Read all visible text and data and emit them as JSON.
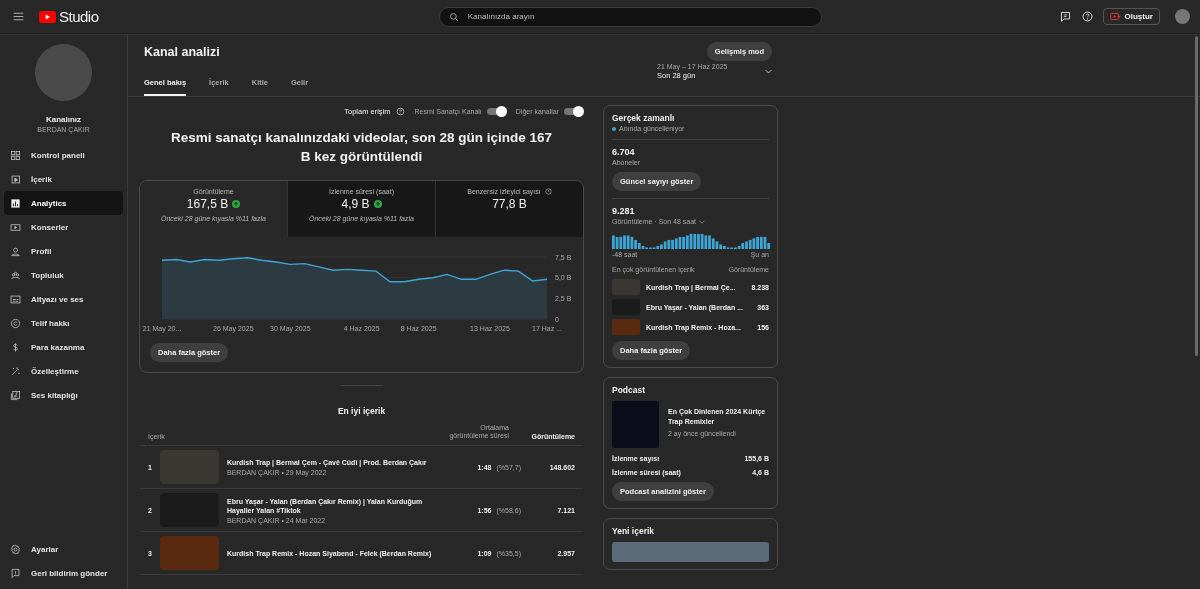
{
  "topbar": {
    "logo": "Studio",
    "search_placeholder": "Kanalınızda arayın",
    "create": "Oluştur"
  },
  "sidebar": {
    "channel_label": "Kanalınız",
    "channel_name": "BERDAN ÇAKIR",
    "items": [
      {
        "label": "Kontrol paneli",
        "selected": false
      },
      {
        "label": "İçerik",
        "selected": false
      },
      {
        "label": "Analytics",
        "selected": true
      },
      {
        "label": "Konserler",
        "selected": false
      },
      {
        "label": "Profil",
        "selected": false
      },
      {
        "label": "Topluluk",
        "selected": false
      },
      {
        "label": "Altyazı ve ses",
        "selected": false
      },
      {
        "label": "Telif hakkı",
        "selected": false
      },
      {
        "label": "Para kazanma",
        "selected": false
      },
      {
        "label": "Özelleştirme",
        "selected": false
      },
      {
        "label": "Ses kitaplığı",
        "selected": false
      }
    ],
    "footer": [
      "Ayarlar",
      "Geri bildirim gönder"
    ]
  },
  "header": {
    "title": "Kanal analizi",
    "advanced_button": "Gelişmiş mod",
    "date_range": "21 May – 17 Haz 2025",
    "period": "Son 28 gün",
    "tabs": [
      {
        "label": "Genel bakış",
        "selected": true
      },
      {
        "label": "İçerik",
        "selected": false
      },
      {
        "label": "Kitle",
        "selected": false
      },
      {
        "label": "Gelir",
        "selected": false
      }
    ]
  },
  "filters": {
    "total_reach": "Toplam erişim",
    "toggles": [
      {
        "label": "Resmi Sanatçı Kanalı",
        "on": true
      },
      {
        "label": "Diğer kanallar",
        "on": true
      }
    ]
  },
  "headline": "Resmi sanatçı kanalınızdaki videolar, son 28 gün içinde 167 B kez görüntülendi",
  "metrics": [
    {
      "label": "Görüntüleme",
      "value": "167,5 B",
      "trend_up": true,
      "note": "Önceki 28 güne kıyasla %11 fazla",
      "selected": true
    },
    {
      "label": "İzlenme süresi (saat)",
      "value": "4,9 B",
      "trend_up": true,
      "note": "Önceki 28 güne kıyasla %11 fazla",
      "selected": false
    },
    {
      "label": "Benzersiz izleyici sayısı",
      "value": "77,8 B",
      "trend_up": false,
      "selected": false
    }
  ],
  "chart_data": {
    "type": "area",
    "categories": [
      "21 May 20...",
      null,
      null,
      null,
      null,
      "26 May 2025",
      null,
      null,
      null,
      "30 May 2025",
      null,
      null,
      null,
      null,
      "4 Haz 2025",
      null,
      null,
      null,
      "8 Haz 2025",
      null,
      null,
      null,
      null,
      "13 Haz 2025",
      null,
      null,
      null,
      "17 Haz ..."
    ],
    "series": [
      {
        "color": "#3ea6d6",
        "values": [
          7.1,
          7.2,
          6.9,
          7.2,
          7.1,
          7.3,
          7.4,
          7.1,
          6.9,
          6.6,
          6.7,
          6.3,
          5.9,
          6.0,
          5.9,
          5.8,
          4.5,
          4.5,
          4.8,
          5.0,
          5.4,
          4.8,
          4.8,
          5.4,
          5.9,
          5.8,
          4.6,
          4.8
        ]
      }
    ],
    "ylim": [
      0,
      7.5
    ],
    "yticks": [
      {
        "value": 0,
        "label": "0"
      },
      {
        "value": 2.5,
        "label": "2,5 B"
      },
      {
        "value": 5,
        "label": "5,0 B"
      },
      {
        "value": 7.5,
        "label": "7,5 B"
      }
    ]
  },
  "more_button": "Daha fazla göster",
  "top_content": {
    "title": "En iyi içerik",
    "columns": [
      "İçerik",
      "Ortalama görüntüleme süresi",
      "Görüntüleme"
    ],
    "rows": [
      {
        "rank": "1",
        "title": "Kurdish Trap | Bermal Çem - Çavê Cûdî | Prod. Berdan Çakır",
        "meta": "BERDAN ÇAKIR • 29 May 2022",
        "duration": "1:48",
        "percent": "(%57,7)",
        "views": "148.602"
      },
      {
        "rank": "2",
        "title": "Ebru Yaşar - Yalan (Berdan Çakır Remix) | Yalan Kurduğum Hayaller Yalan #Tiktok",
        "meta": "BERDAN ÇAKIR • 24 Mar 2022",
        "duration": "1:56",
        "percent": "(%58,6)",
        "views": "7.121"
      },
      {
        "rank": "3",
        "title": "Kurdish Trap Remix - Hozan Siyabend - Felek (Berdan Remix)",
        "duration": "1:09",
        "percent": "(%35,5)",
        "views": "2.957"
      }
    ]
  },
  "realtime": {
    "title": "Gerçek zamanlı",
    "status": "Anında güncelleniyor",
    "subscribers": "6.704",
    "subscribers_label": "Aboneler",
    "count_button": "Güncel sayıyı göster",
    "views": "9.281",
    "views_label": "Görüntüleme · Son 48 saat",
    "axis_start": "-48 saat",
    "axis_end": "Şu an",
    "list_header": "En çok görüntülenen içerik",
    "list_value_header": "Görüntüleme",
    "items": [
      {
        "title": "Kurdish Trap | Bermal Çe...",
        "views": "8.238"
      },
      {
        "title": "Ebru Yaşar - Yalan (Berdan ...",
        "views": "363"
      },
      {
        "title": "Kurdish Trap Remix - Hoza...",
        "views": "156"
      }
    ],
    "more_button": "Daha fazla göster"
  },
  "podcast": {
    "title": "Podcast",
    "name": "En Çok Dinlenen 2024 Kürtçe Trap Remixler",
    "updated": "2 ay önce güncellendi",
    "stats": [
      {
        "label": "İzlenme sayısı",
        "value": "155,6 B"
      },
      {
        "label": "İzlenme süresi (saat)",
        "value": "4,6 B"
      }
    ],
    "button": "Podcast analizini göster"
  },
  "new_content": {
    "title": "Yeni içerik"
  }
}
